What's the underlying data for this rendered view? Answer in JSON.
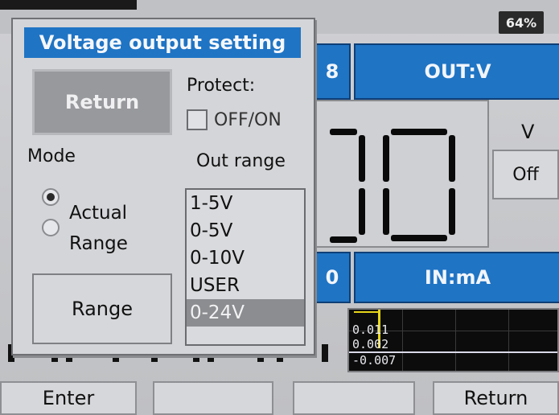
{
  "status": {
    "battery_text": "64%"
  },
  "header": {
    "out_label": "OUT:V",
    "in_label": "IN:mA"
  },
  "readout": {
    "unit": "V",
    "off_button": "Off",
    "out_left_glyph": "8",
    "in_left_glyph": "0"
  },
  "graph": {
    "labels": [
      "0.011",
      "0.002",
      "-0.007"
    ]
  },
  "softkeys": [
    "Enter",
    "",
    "",
    "Return"
  ],
  "dialog": {
    "title": "Voltage output setting",
    "return_label": "Return",
    "protect_label": "Protect:",
    "protect_option": "OFF/ON",
    "mode_label": "Mode",
    "mode_options": [
      {
        "label": "Actual",
        "selected": true
      },
      {
        "label": "Range",
        "selected": false
      }
    ],
    "range_button": "Range",
    "out_range_label": "Out range",
    "out_range_options": [
      "1-5V",
      "0-5V",
      "0-10V",
      "USER",
      "0-24V"
    ],
    "out_range_selected": "0-24V"
  },
  "colors": {
    "accent_blue": "#1f74c4",
    "selected_gray": "#8c8d90",
    "graph_yellow": "#e6d61a"
  }
}
